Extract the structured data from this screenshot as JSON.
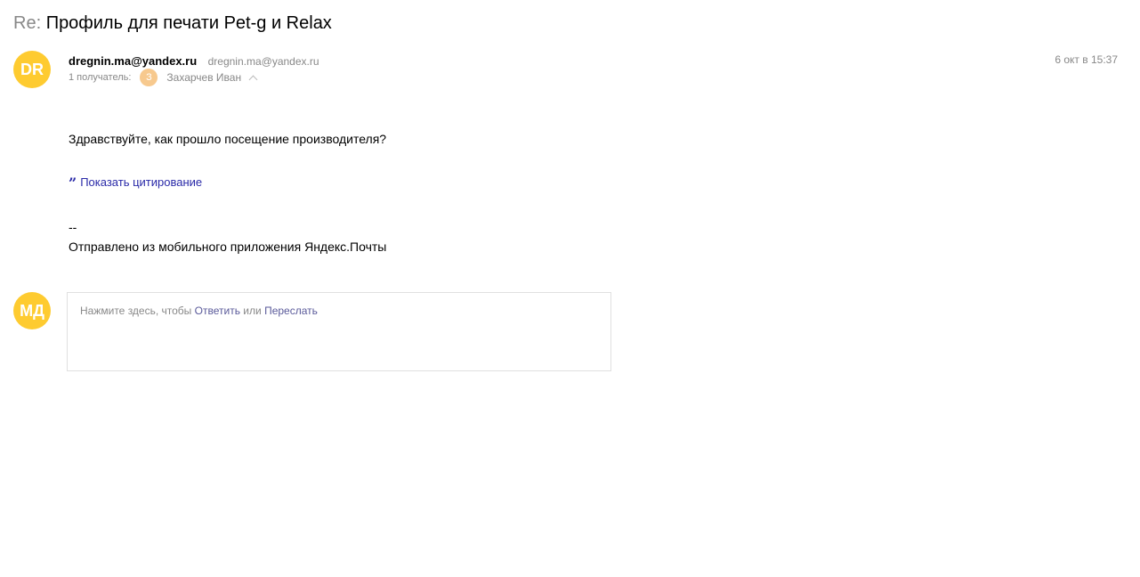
{
  "message": {
    "subject_prefix": "Re:",
    "subject": "Профиль для печати Pet-g и Relax",
    "sender": {
      "initials": "DR",
      "name": "dregnin.ma@yandex.ru",
      "email": "dregnin.ma@yandex.ru",
      "avatar_color": "#fecb30"
    },
    "date": "6 окт в 15:37",
    "recipients": {
      "label": "1 получатель:",
      "avatar_initial": "З",
      "avatar_color": "#f7c98e",
      "name": "Захарчев Иван"
    },
    "body": {
      "greeting": "Здравствуйте, как прошло посещение производителя?",
      "show_quote_label": "Показать цитирование",
      "signature_dash": "--",
      "signature": "Отправлено из мобильного приложения Яндекс.Почты"
    }
  },
  "reply": {
    "user_initials": "МД",
    "avatar_color": "#fecb30",
    "hint_prefix": "Нажмите здесь, чтобы",
    "reply_label": "Ответить",
    "or_label": "или",
    "forward_label": "Переслать"
  },
  "colors": {
    "link": "#2a2aa8",
    "muted": "#888888",
    "reply_link": "#5a5a9a"
  }
}
